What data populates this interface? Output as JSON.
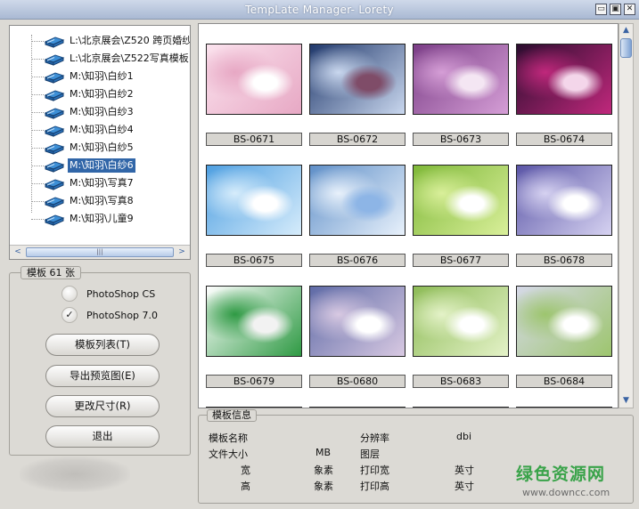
{
  "window": {
    "title": "TempLate Manager- Lorety",
    "controls": [
      "minimize-icon",
      "restore-icon",
      "close-icon"
    ],
    "control_glyphs": [
      "▭",
      "▣",
      "✕"
    ]
  },
  "tree": {
    "items": [
      {
        "label": "L:\\北京展会\\Z520 跨页婚纱",
        "selected": false
      },
      {
        "label": "L:\\北京展会\\Z522写真模板",
        "selected": false
      },
      {
        "label": "M:\\知羽\\白纱1",
        "selected": false
      },
      {
        "label": "M:\\知羽\\白纱2",
        "selected": false
      },
      {
        "label": "M:\\知羽\\白纱3",
        "selected": false
      },
      {
        "label": "M:\\知羽\\白纱4",
        "selected": false
      },
      {
        "label": "M:\\知羽\\白纱5",
        "selected": false
      },
      {
        "label": "M:\\知羽\\白纱6",
        "selected": true
      },
      {
        "label": "M:\\知羽\\写真7",
        "selected": false
      },
      {
        "label": "M:\\知羽\\写真8",
        "selected": false
      },
      {
        "label": "M:\\知羽\\儿童9",
        "selected": false
      }
    ],
    "scroll_left": "<",
    "scroll_right": ">",
    "scroll_grip": "|||"
  },
  "templates_group": {
    "title": "模板 61 张",
    "options": [
      {
        "label": "PhotoShop CS",
        "checked": false
      },
      {
        "label": "PhotoShop 7.0",
        "checked": true
      }
    ],
    "checkmark": "✓",
    "buttons": [
      "模板列表(T)",
      "导出预览图(E)",
      "更改尺寸(R)",
      "退出"
    ]
  },
  "gallery": {
    "scroll_up": "▲",
    "scroll_down": "▼",
    "thumbnails": [
      {
        "label": "BS-0671",
        "colors": [
          "#fbe3ee",
          "#e7a8c4",
          "#ffffff"
        ]
      },
      {
        "label": "BS-0672",
        "colors": [
          "#20386b",
          "#c9d7ee",
          "#7f4c68"
        ]
      },
      {
        "label": "BS-0673",
        "colors": [
          "#7a3d86",
          "#d59ed6",
          "#f4e6f3"
        ]
      },
      {
        "label": "BS-0674",
        "colors": [
          "#2a0d2e",
          "#c0287c",
          "#f4d6ea"
        ]
      },
      {
        "label": "BS-0675",
        "colors": [
          "#4e9fe1",
          "#d6ecfb",
          "#ffffff"
        ]
      },
      {
        "label": "BS-0676",
        "colors": [
          "#5f8fc8",
          "#e8f1fb",
          "#8db5e6"
        ]
      },
      {
        "label": "BS-0677",
        "colors": [
          "#7fb838",
          "#d9ef9a",
          "#ffffff"
        ]
      },
      {
        "label": "BS-0678",
        "colors": [
          "#5a55a6",
          "#d6d2f1",
          "#ffffff"
        ]
      },
      {
        "label": "BS-0679",
        "colors": [
          "#ffffff",
          "#2f9a44",
          "#f2f2f2"
        ]
      },
      {
        "label": "BS-0680",
        "colors": [
          "#5e6aa6",
          "#d8c9e2",
          "#ffffff"
        ]
      },
      {
        "label": "BS-0683",
        "colors": [
          "#8dbb56",
          "#e4f2c8",
          "#ffffff"
        ]
      },
      {
        "label": "BS-0684",
        "colors": [
          "#d6d9e8",
          "#9dc56e",
          "#ffffff"
        ]
      }
    ]
  },
  "info": {
    "title": "模板信息",
    "name_label": "模板名称",
    "resolution_label": "分辨率",
    "resolution_unit": "dbi",
    "filesize_label": "文件大小",
    "filesize_unit": "MB",
    "layers_label": "图层",
    "width_label": "宽",
    "pixel_unit_1": "象素",
    "print_width_label": "打印宽",
    "inch_unit_1": "英寸",
    "height_label": "高",
    "pixel_unit_2": "象素",
    "print_height_label": "打印高",
    "inch_unit_2": "英寸"
  },
  "watermark": {
    "brand": "绿色资源网",
    "url": "www.downcc.com"
  }
}
